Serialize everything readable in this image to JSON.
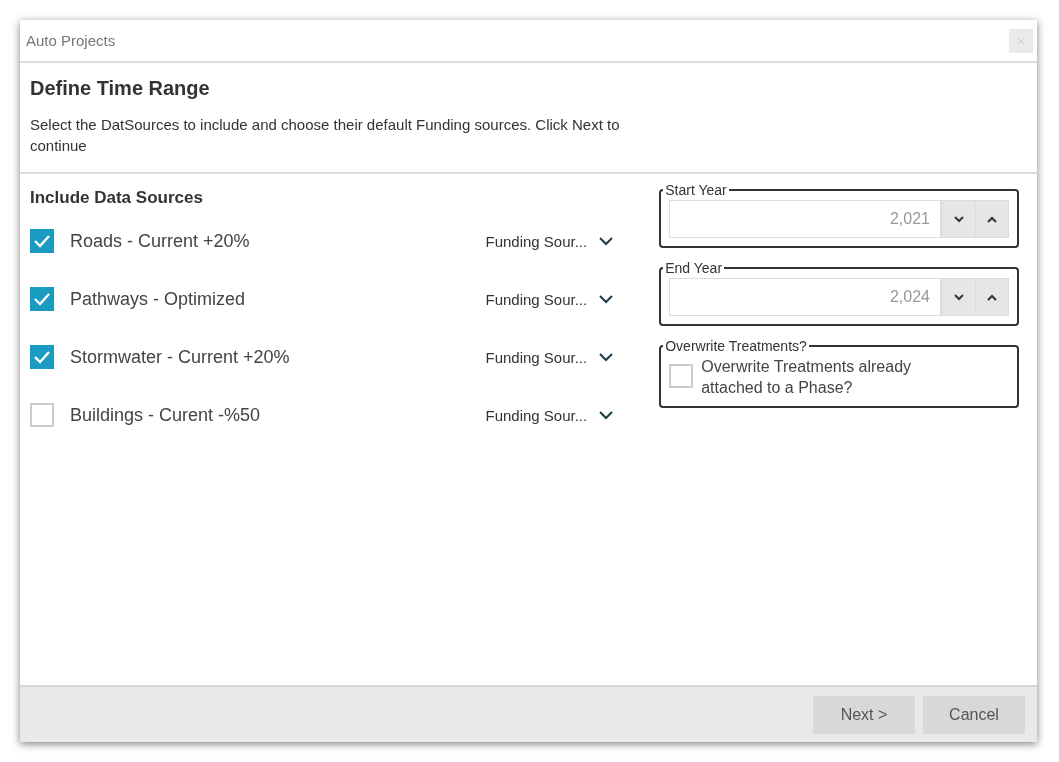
{
  "window": {
    "title": "Auto Projects"
  },
  "header": {
    "title": "Define Time Range",
    "description": "Select the DatSources to include and choose their default Funding sources. Click Next to continue"
  },
  "data_sources": {
    "heading": "Include Data Sources",
    "items": [
      {
        "label": "Roads - Current +20%",
        "checked": true,
        "funding": "Funding Sour..."
      },
      {
        "label": "Pathways - Optimized",
        "checked": true,
        "funding": "Funding Sour..."
      },
      {
        "label": "Stormwater - Current +20%",
        "checked": true,
        "funding": "Funding Sour..."
      },
      {
        "label": "Buildings - Curent -%50",
        "checked": false,
        "funding": "Funding Sour..."
      }
    ]
  },
  "start_year": {
    "legend": "Start Year",
    "value": "2,021"
  },
  "end_year": {
    "legend": "End Year",
    "value": "2,024"
  },
  "overwrite": {
    "legend": "Overwrite Treatments?",
    "label": "Overwrite Treatments already attached to a Phase?",
    "checked": false
  },
  "buttons": [
    {
      "label": "Next >"
    },
    {
      "label": "Cancel"
    }
  ]
}
